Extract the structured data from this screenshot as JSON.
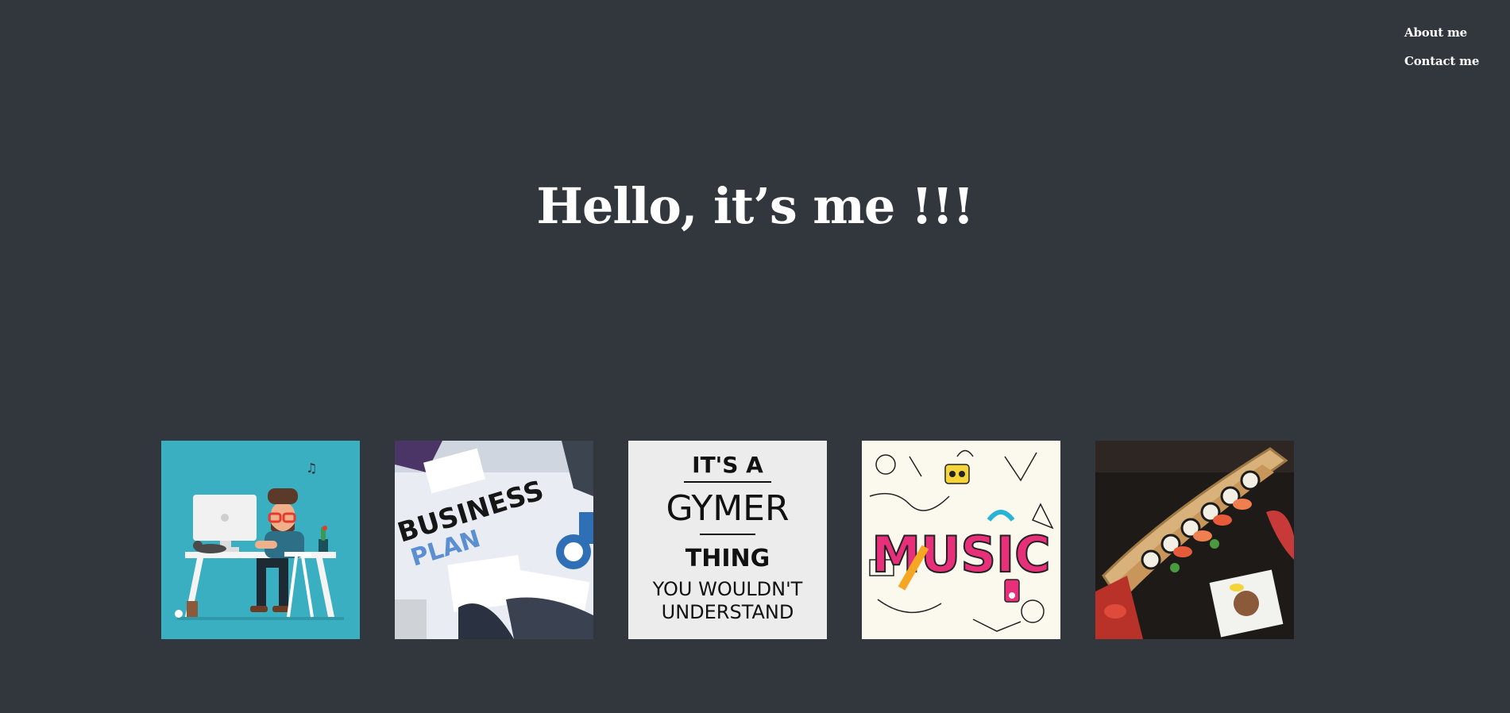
{
  "nav": {
    "about_label": "About me",
    "contact_label": "Contact me"
  },
  "hero": {
    "title": "Hello, it’s me !!!"
  },
  "gallery": {
    "tiles": [
      {
        "name": "developer-illustration"
      },
      {
        "name": "business-plan-photo",
        "heading_1": "BUSINESS",
        "heading_2": "PLAN"
      },
      {
        "name": "gymer-thing-poster",
        "line_1": "IT'S A",
        "line_2": "GYMER",
        "line_3": "THING",
        "line_4": "YOU WOULDN'T",
        "line_5": "UNDERSTAND"
      },
      {
        "name": "music-doodle-art",
        "word": "MUSIC"
      },
      {
        "name": "sushi-boat-photo"
      }
    ]
  },
  "colors": {
    "background": "#32363d",
    "text": "#ffffff",
    "teal": "#3aafc2"
  }
}
